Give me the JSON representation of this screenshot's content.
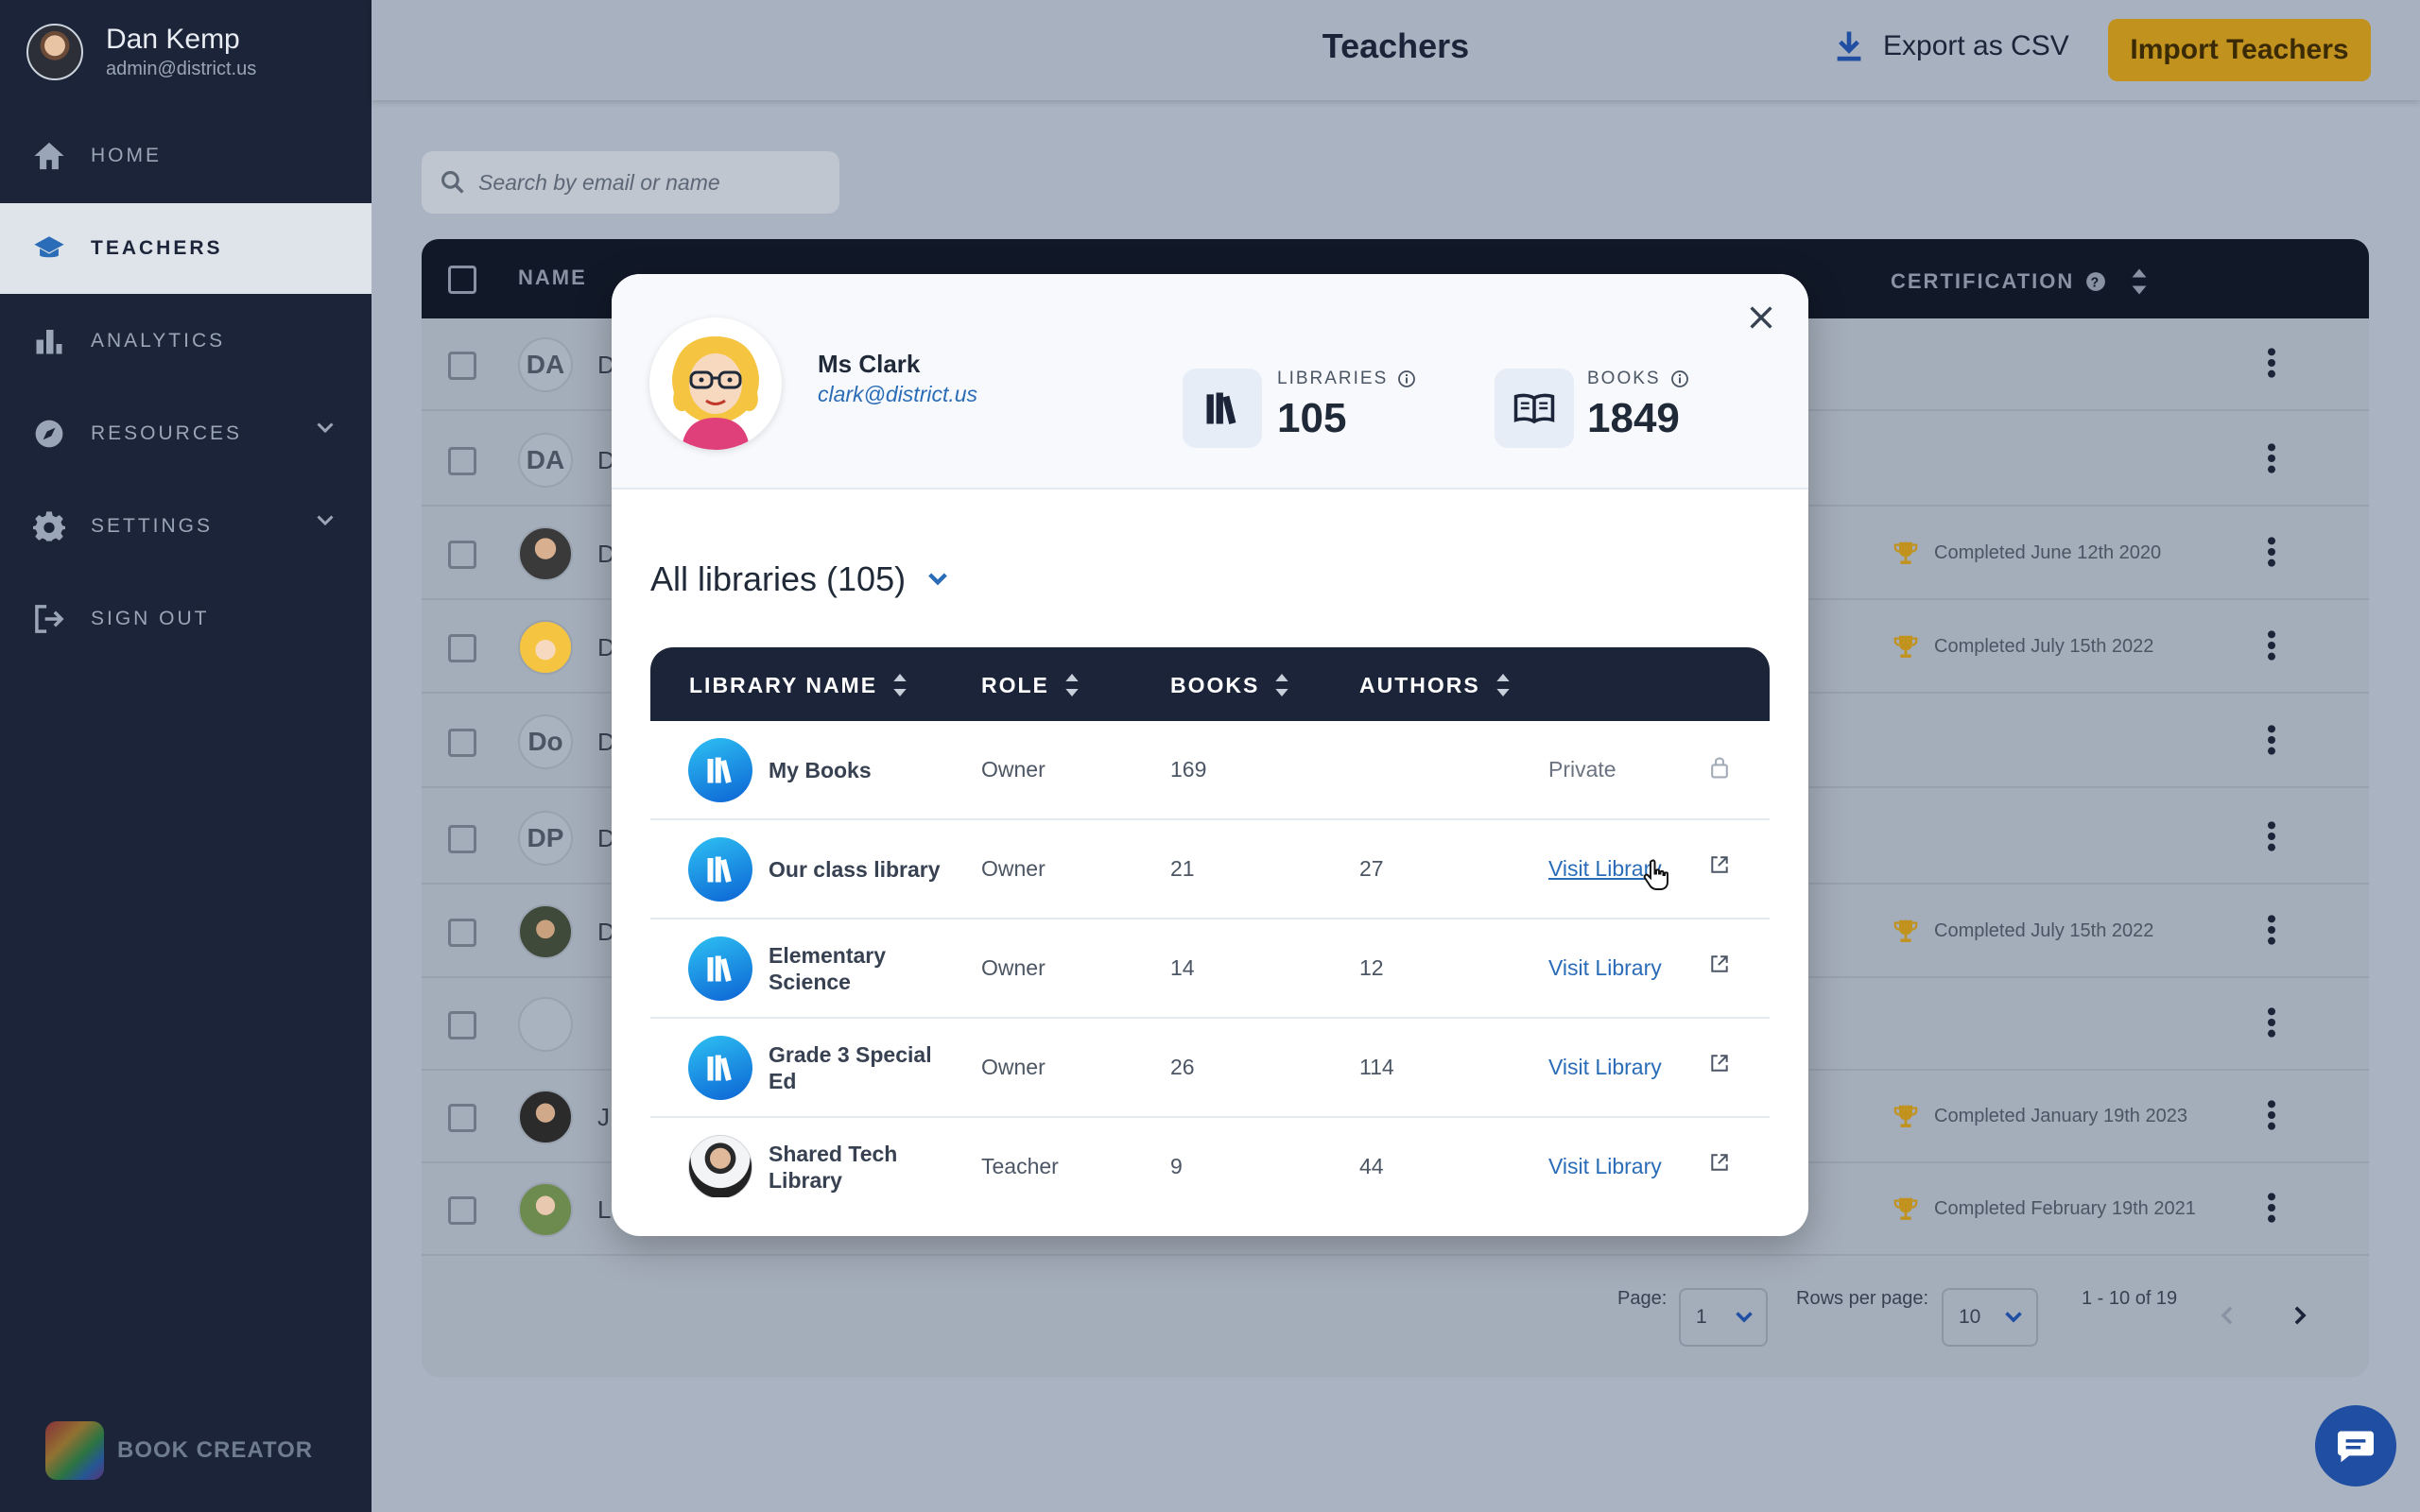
{
  "sidebar": {
    "user": {
      "name": "Dan Kemp",
      "email": "admin@district.us"
    },
    "items": [
      {
        "label": "HOME",
        "icon": "home-icon"
      },
      {
        "label": "TEACHERS",
        "icon": "graduation-cap-icon"
      },
      {
        "label": "ANALYTICS",
        "icon": "bar-chart-icon"
      },
      {
        "label": "RESOURCES",
        "icon": "compass-icon"
      },
      {
        "label": "SETTINGS",
        "icon": "gear-icon"
      },
      {
        "label": "SIGN OUT",
        "icon": "sign-out-icon"
      }
    ],
    "active": "TEACHERS",
    "brand": "BOOK CREATOR"
  },
  "header": {
    "title": "Teachers",
    "export_label": "Export as CSV",
    "import_label": "Import Teachers"
  },
  "search": {
    "placeholder": "Search by email or name"
  },
  "table": {
    "columns": [
      "NAME",
      "CERTIFICATION"
    ],
    "rows": [
      {
        "initials": "DA",
        "name_initial": "D",
        "certification": ""
      },
      {
        "initials": "DA",
        "name_initial": "D",
        "certification": ""
      },
      {
        "initials": "",
        "name_initial": "D",
        "certification": "Completed June 12th 2020"
      },
      {
        "initials": "",
        "name_initial": "D",
        "certification": "Completed July 15th 2022"
      },
      {
        "initials": "Do",
        "name_initial": "D",
        "certification": ""
      },
      {
        "initials": "DP",
        "name_initial": "D",
        "certification": ""
      },
      {
        "initials": "",
        "name_initial": "D",
        "certification": "Completed July 15th 2022"
      },
      {
        "initials": "",
        "name_initial": "",
        "certification": ""
      },
      {
        "initials": "",
        "name_initial": "J",
        "certification": "Completed January 19th 2023"
      },
      {
        "initials": "",
        "name_initial": "L",
        "certification": "Completed February 19th 2021"
      }
    ]
  },
  "pagination": {
    "page_label": "Page:",
    "page_value": "1",
    "rows_label": "Rows per page:",
    "rows_value": "10",
    "range": "1 - 10 of 19"
  },
  "modal": {
    "teacher": {
      "name": "Ms Clark",
      "email": "clark@district.us"
    },
    "stats": {
      "libraries_label": "LIBRARIES",
      "libraries_value": "105",
      "books_label": "BOOKS",
      "books_value": "1849"
    },
    "filter_label": "All libraries (105)",
    "columns": {
      "name": "LIBRARY NAME",
      "role": "ROLE",
      "books": "BOOKS",
      "authors": "AUTHORS"
    },
    "libraries": [
      {
        "name": "My Books",
        "role": "Owner",
        "books": "169",
        "authors": "",
        "action": "Private"
      },
      {
        "name": "Our class library",
        "role": "Owner",
        "books": "21",
        "authors": "27",
        "action": "Visit Library"
      },
      {
        "name": "Elementary Science",
        "role": "Owner",
        "books": "14",
        "authors": "12",
        "action": "Visit Library"
      },
      {
        "name": "Grade 3 Special Ed",
        "role": "Owner",
        "books": "26",
        "authors": "114",
        "action": "Visit Library"
      },
      {
        "name": "Shared Tech Library",
        "role": "Teacher",
        "books": "9",
        "authors": "44",
        "action": "Visit Library"
      }
    ]
  },
  "colors": {
    "sidebar": "#1b2438",
    "accent": "#c1921d",
    "link": "#2a6cb7"
  }
}
